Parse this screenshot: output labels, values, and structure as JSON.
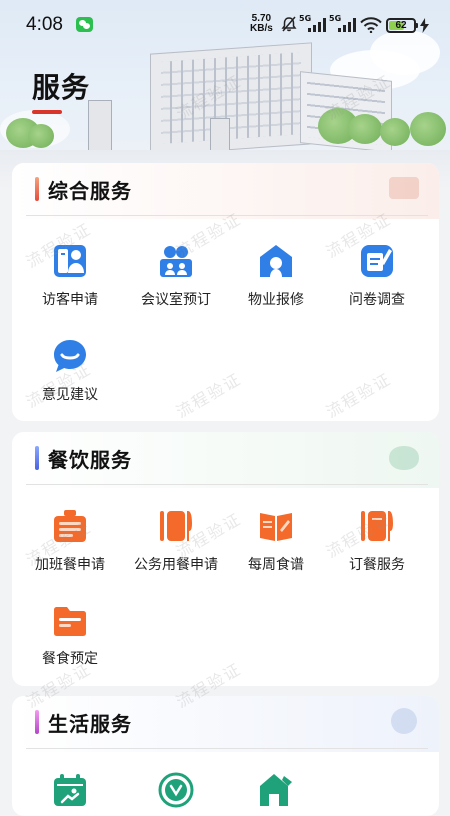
{
  "status_bar": {
    "time": "4:08",
    "speed_value": "5.70",
    "speed_unit": "KB/s",
    "network_a": "5G",
    "network_b": "5G",
    "battery": "62",
    "battery_level": 0.62
  },
  "page": {
    "title": "服务"
  },
  "colors": {
    "title_underline": "#d9362b",
    "blue_icon": "#2f7fe6",
    "orange_icon": "#f36a2b",
    "green_icon": "#1fa27a"
  },
  "sections": [
    {
      "title": "综合服务",
      "accent": "#f07a5e",
      "items": [
        {
          "label": "访客申请",
          "icon": "visitor-icon"
        },
        {
          "label": "会议室预订",
          "icon": "meeting-room-icon"
        },
        {
          "label": "物业报修",
          "icon": "property-repair-icon"
        },
        {
          "label": "问卷调查",
          "icon": "questionnaire-icon"
        },
        {
          "label": "意见建议",
          "icon": "feedback-icon"
        }
      ]
    },
    {
      "title": "餐饮服务",
      "accent": "#5b7cf0",
      "items": [
        {
          "label": "加班餐申请",
          "icon": "overtime-meal-icon"
        },
        {
          "label": "公务用餐申请",
          "icon": "official-meal-icon"
        },
        {
          "label": "每周食谱",
          "icon": "weekly-menu-icon"
        },
        {
          "label": "订餐服务",
          "icon": "order-meal-icon"
        },
        {
          "label": "餐食预定",
          "icon": "meal-reservation-icon"
        }
      ]
    },
    {
      "title": "生活服务",
      "accent": "#d65ad8",
      "items": [
        {
          "label": "",
          "icon": "sports-calendar-icon"
        },
        {
          "label": "",
          "icon": "fitness-icon"
        },
        {
          "label": "",
          "icon": "home-service-icon"
        }
      ]
    }
  ],
  "watermark": {
    "text": "流程验证"
  }
}
